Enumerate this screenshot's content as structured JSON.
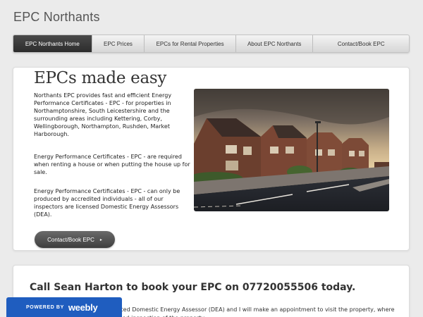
{
  "site": {
    "title": "EPC Northants"
  },
  "nav": {
    "items": [
      {
        "label": "EPC Northants Home",
        "active": true
      },
      {
        "label": "EPC Prices"
      },
      {
        "label": "EPCs for Rental Properties"
      },
      {
        "label": "About EPC Northants"
      },
      {
        "label": "Contact/Book EPC"
      }
    ]
  },
  "hero": {
    "title": "EPCs made easy",
    "paragraph1": "Northants EPC provides fast and efficient Energy Performance Certificates - EPC - for properties in Northamptonshire, South Leicestershire  and the surrounding areas including Kettering, Corby, Wellingborough, Northampton, Rushden, Market Harborough.",
    "paragraph2": "Energy Performance Certificates - EPC - are required when renting a house or when putting the house up for sale.",
    "paragraph3": "Energy Performance Certificates - EPC - can only be produced by accredited individuals - all of our inspectors are licensed Domestic Energy Assessors (DEA).",
    "cta_label": "Contact/Book EPC",
    "cta_arrow": "▸"
  },
  "call": {
    "heading": "Call Sean Harton to book your EPC on 07720055506 today.",
    "body": "I am a qualified Diploma accredited Domestic Energy Assessor (DEA) and I will make an appointment to visit the property, where I will make a thorough and detailed inspection of the property."
  },
  "footer": {
    "powered_by": "POWERED BY",
    "brand": "weebly"
  },
  "colors": {
    "nav_active": "#333333",
    "weebly_blue": "#1f5dbf"
  }
}
